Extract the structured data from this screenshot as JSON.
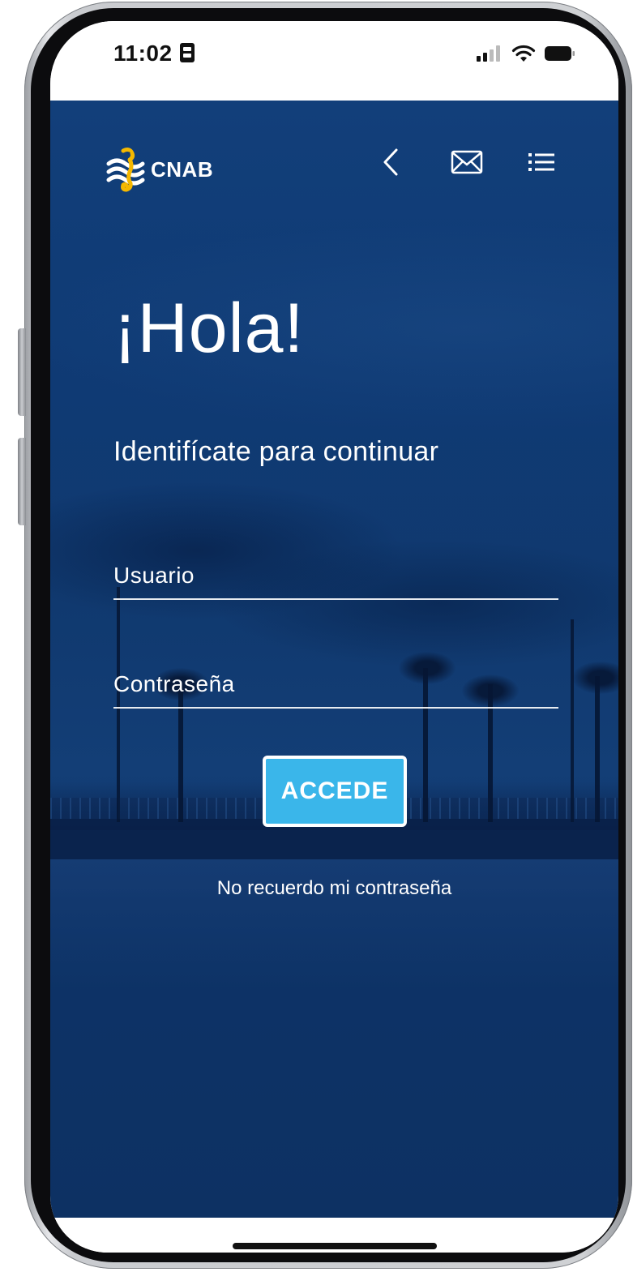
{
  "status_bar": {
    "time": "11:02",
    "signal_icon": "cellular-signal-icon",
    "wifi_icon": "wifi-icon",
    "battery_icon": "battery-icon"
  },
  "header": {
    "logo_text": "CNAB",
    "logo_icon": "seahorse-logo-icon",
    "back_icon": "chevron-left-icon",
    "mail_icon": "envelope-icon",
    "menu_icon": "list-menu-icon"
  },
  "login": {
    "title": "¡Hola!",
    "subtitle": "Identifícate para continuar",
    "username_placeholder": "Usuario",
    "password_placeholder": "Contraseña",
    "submit_label": "ACCEDE",
    "forgot_link": "No recuerdo mi contraseña"
  },
  "colors": {
    "background_blue": "#10396f",
    "button_blue": "#3ab6ea",
    "logo_yellow": "#f5b800",
    "text": "#ffffff"
  }
}
